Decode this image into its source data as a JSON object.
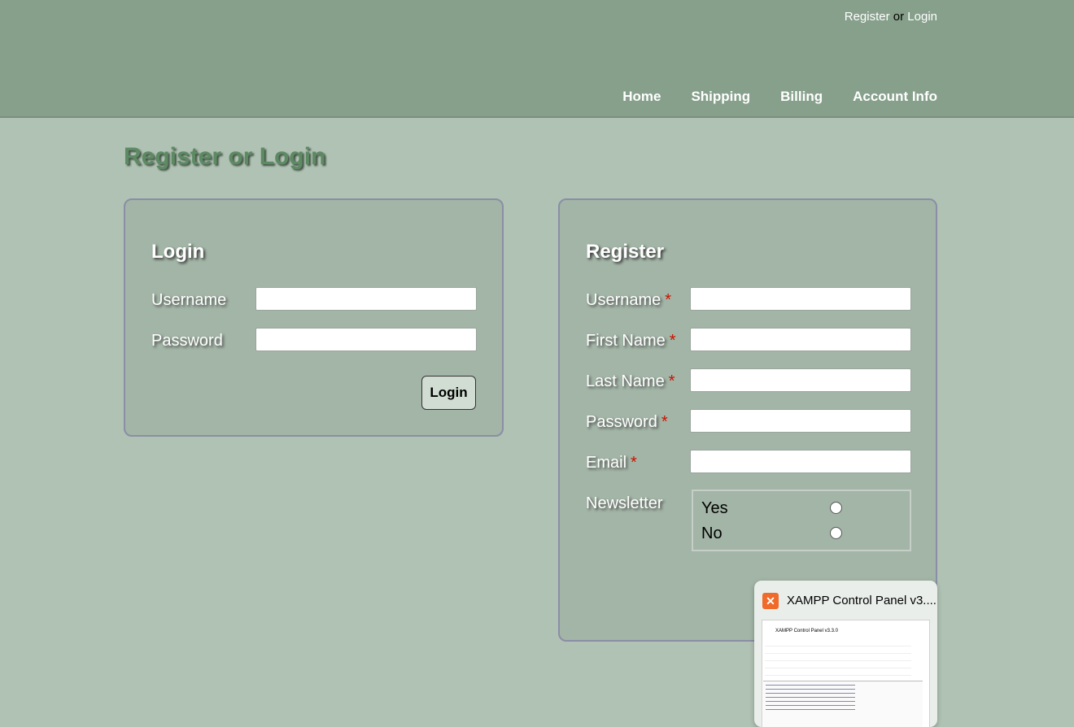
{
  "header": {
    "toplinks": {
      "register": "Register",
      "or": "or",
      "login": "Login"
    },
    "nav": [
      "Home",
      "Shipping",
      "Billing",
      "Account Info"
    ]
  },
  "page_title": "Register or Login",
  "login": {
    "title": "Login",
    "username_label": "Username",
    "password_label": "Password",
    "button": "Login"
  },
  "register": {
    "title": "Register",
    "required_mark": "*",
    "fields": [
      "Username",
      "First Name",
      "Last Name",
      "Password",
      "Email"
    ],
    "newsletter_label": "Newsletter",
    "options": [
      "Yes",
      "No"
    ]
  },
  "taskbar_preview": {
    "title": "XAMPP Control Panel v3....",
    "thumb_title": "XAMPP Control Panel v3.3.0",
    "icon": "xampp-icon"
  }
}
